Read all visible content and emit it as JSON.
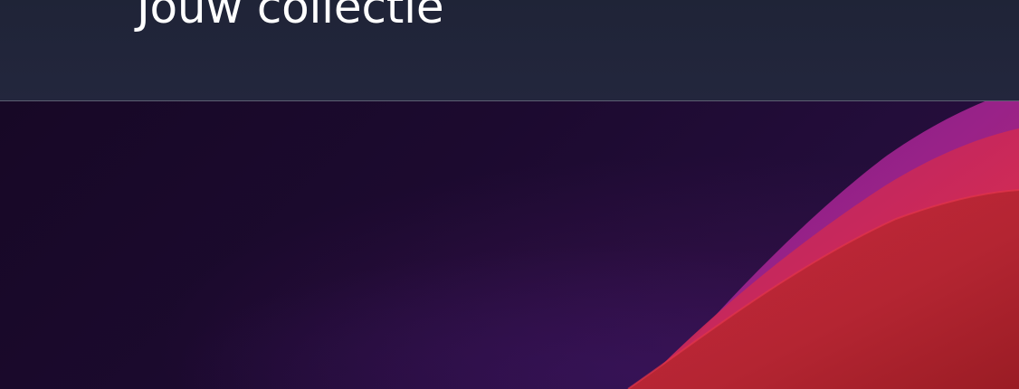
{
  "header": {
    "title": "Jouw collectie"
  },
  "colors": {
    "header_bg": "#22253a",
    "hero_bg": "#1c0a2f",
    "wave_magenta": "#a3248f",
    "wave_pink": "#d02a55",
    "wave_red": "#b42532"
  }
}
